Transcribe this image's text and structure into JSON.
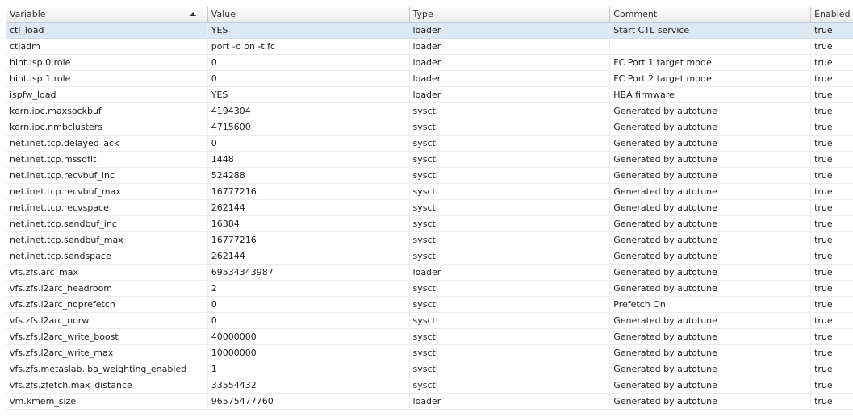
{
  "table": {
    "columns": [
      {
        "key": "variable",
        "label": "Variable",
        "sorted": "ascending"
      },
      {
        "key": "value",
        "label": "Value"
      },
      {
        "key": "type",
        "label": "Type"
      },
      {
        "key": "comment",
        "label": "Comment"
      },
      {
        "key": "enabled",
        "label": "Enabled"
      }
    ],
    "selected_row": 0,
    "rows": [
      {
        "variable": "ctl_load",
        "value": "YES",
        "type": "loader",
        "comment": "Start CTL service",
        "enabled": "true"
      },
      {
        "variable": "ctladm",
        "value": "port -o on -t fc",
        "type": "loader",
        "comment": "",
        "enabled": "true"
      },
      {
        "variable": "hint.isp.0.role",
        "value": "0",
        "type": "loader",
        "comment": "FC Port 1 target mode",
        "enabled": "true"
      },
      {
        "variable": "hint.isp.1.role",
        "value": "0",
        "type": "loader",
        "comment": "FC Port 2 target mode",
        "enabled": "true"
      },
      {
        "variable": "ispfw_load",
        "value": "YES",
        "type": "loader",
        "comment": "HBA firmware",
        "enabled": "true"
      },
      {
        "variable": "kern.ipc.maxsockbuf",
        "value": "4194304",
        "type": "sysctl",
        "comment": "Generated by autotune",
        "enabled": "true"
      },
      {
        "variable": "kern.ipc.nmbclusters",
        "value": "4715600",
        "type": "sysctl",
        "comment": "Generated by autotune",
        "enabled": "true"
      },
      {
        "variable": "net.inet.tcp.delayed_ack",
        "value": "0",
        "type": "sysctl",
        "comment": "Generated by autotune",
        "enabled": "true"
      },
      {
        "variable": "net.inet.tcp.mssdflt",
        "value": "1448",
        "type": "sysctl",
        "comment": "Generated by autotune",
        "enabled": "true"
      },
      {
        "variable": "net.inet.tcp.recvbuf_inc",
        "value": "524288",
        "type": "sysctl",
        "comment": "Generated by autotune",
        "enabled": "true"
      },
      {
        "variable": "net.inet.tcp.recvbuf_max",
        "value": "16777216",
        "type": "sysctl",
        "comment": "Generated by autotune",
        "enabled": "true"
      },
      {
        "variable": "net.inet.tcp.recvspace",
        "value": "262144",
        "type": "sysctl",
        "comment": "Generated by autotune",
        "enabled": "true"
      },
      {
        "variable": "net.inet.tcp.sendbuf_inc",
        "value": "16384",
        "type": "sysctl",
        "comment": "Generated by autotune",
        "enabled": "true"
      },
      {
        "variable": "net.inet.tcp.sendbuf_max",
        "value": "16777216",
        "type": "sysctl",
        "comment": "Generated by autotune",
        "enabled": "true"
      },
      {
        "variable": "net.inet.tcp.sendspace",
        "value": "262144",
        "type": "sysctl",
        "comment": "Generated by autotune",
        "enabled": "true"
      },
      {
        "variable": "vfs.zfs.arc_max",
        "value": "69534343987",
        "type": "loader",
        "comment": "Generated by autotune",
        "enabled": "true"
      },
      {
        "variable": "vfs.zfs.l2arc_headroom",
        "value": "2",
        "type": "sysctl",
        "comment": "Generated by autotune",
        "enabled": "true"
      },
      {
        "variable": "vfs.zfs.l2arc_noprefetch",
        "value": "0",
        "type": "sysctl",
        "comment": "Prefetch On",
        "enabled": "true"
      },
      {
        "variable": "vfs.zfs.l2arc_norw",
        "value": "0",
        "type": "sysctl",
        "comment": "Generated by autotune",
        "enabled": "true"
      },
      {
        "variable": "vfs.zfs.l2arc_write_boost",
        "value": "40000000",
        "type": "sysctl",
        "comment": "Generated by autotune",
        "enabled": "true"
      },
      {
        "variable": "vfs.zfs.l2arc_write_max",
        "value": "10000000",
        "type": "sysctl",
        "comment": "Generated by autotune",
        "enabled": "true"
      },
      {
        "variable": "vfs.zfs.metaslab.lba_weighting_enabled",
        "value": "1",
        "type": "sysctl",
        "comment": "Generated by autotune",
        "enabled": "true"
      },
      {
        "variable": "vfs.zfs.zfetch.max_distance",
        "value": "33554432",
        "type": "sysctl",
        "comment": "Generated by autotune",
        "enabled": "true"
      },
      {
        "variable": "vm.kmem_size",
        "value": "96575477760",
        "type": "loader",
        "comment": "Generated by autotune",
        "enabled": "true"
      }
    ]
  }
}
